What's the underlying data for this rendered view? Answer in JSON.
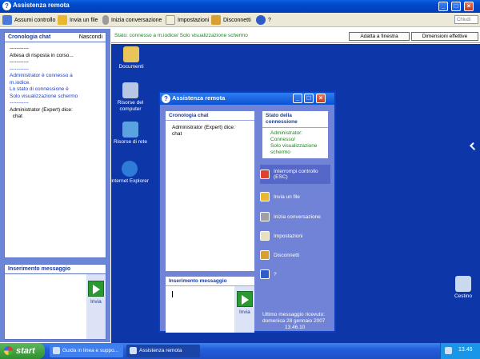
{
  "window": {
    "title": "Assistenza remota"
  },
  "toolbar": {
    "items": [
      {
        "label": "Assumi controllo",
        "icon": "take-control-icon"
      },
      {
        "label": "Invia un file",
        "icon": "send-file-icon"
      },
      {
        "label": "Inizia conversazione",
        "icon": "microphone-icon"
      },
      {
        "label": "Impostazioni",
        "icon": "settings-icon"
      },
      {
        "label": "Disconnetti",
        "icon": "disconnect-icon"
      },
      {
        "label": "?",
        "icon": "help-icon"
      }
    ],
    "search_placeholder": "Chiudi"
  },
  "left_pane": {
    "chat_title": "Cronologia chat",
    "hide_label": "Nascondi",
    "chat_lines": [
      {
        "text": "-----------",
        "blue": false
      },
      {
        "text": "Attesa di risposta in corso...",
        "blue": false
      },
      {
        "text": "-----------",
        "blue": false
      },
      {
        "text": "-----------",
        "blue": true
      },
      {
        "text": "Administrator è connesso a",
        "blue": true
      },
      {
        "text": "m.iodice.",
        "blue": true
      },
      {
        "text": "Lo stato di connessione è",
        "blue": true
      },
      {
        "text": "Solo visualizzazione schermo",
        "blue": true
      },
      {
        "text": "-----------",
        "blue": true
      },
      {
        "text": "",
        "blue": false
      },
      {
        "text": "Administrator (Expert) dice:",
        "blue": false
      },
      {
        "text": "  chat",
        "blue": false
      }
    ],
    "input_title": "Inserimento messaggio",
    "send_label": "Invia"
  },
  "status_bar": {
    "text": "Stato: connesso a m.iodice/ Solo visualizzazione schermo",
    "fit_label": "Adatta a finestra",
    "actual_label": "Dimensioni effettive"
  },
  "desktop_icons": [
    {
      "label": "Documenti",
      "color": "#e9c45a"
    },
    {
      "label": "Risorse del computer",
      "color": "#b7c7e6"
    },
    {
      "label": "Risorse di rete",
      "color": "#5aa2e0"
    },
    {
      "label": "Internet Explorer",
      "color": "#2e7bd8"
    },
    {
      "label": "Cestino",
      "color": "#c9d9ee"
    }
  ],
  "inner_window": {
    "title": "Assistenza remota",
    "chat_title": "Cronologia chat",
    "chat_lines": [
      "Administrator (Expert) dice:",
      "chat"
    ],
    "status_title": "Stato della connessione",
    "status_lines": [
      "Administrator:",
      "Connesso/",
      "Solo visualizzazione",
      "schermo"
    ],
    "actions": [
      {
        "label": "Interrompi controllo (ESC)",
        "icon": "stop-control-icon",
        "color": "#e04030"
      },
      {
        "label": "Invia un file",
        "icon": "send-file-icon",
        "color": "#e8b830"
      },
      {
        "label": "Inizia conversazione",
        "icon": "microphone-icon",
        "color": "#a0a0a0"
      },
      {
        "label": "Impostazioni",
        "icon": "settings-icon",
        "color": "#e8e0c0"
      },
      {
        "label": "Disconnetti",
        "icon": "disconnect-icon",
        "color": "#d8a030"
      },
      {
        "label": "?",
        "icon": "help-icon",
        "color": "#2d5cc8"
      }
    ],
    "input_title": "Inserimento messaggio",
    "send_label": "Invia",
    "last_message_lines": [
      "Ultimo messaggio ricevuto:",
      "domenica 28 gennaio 2007",
      "13.46.10"
    ]
  },
  "taskbar": {
    "start_label": "start",
    "tasks": [
      "Guida in linea e suppo...",
      "Assistenza remota"
    ],
    "clock": "13.46"
  }
}
